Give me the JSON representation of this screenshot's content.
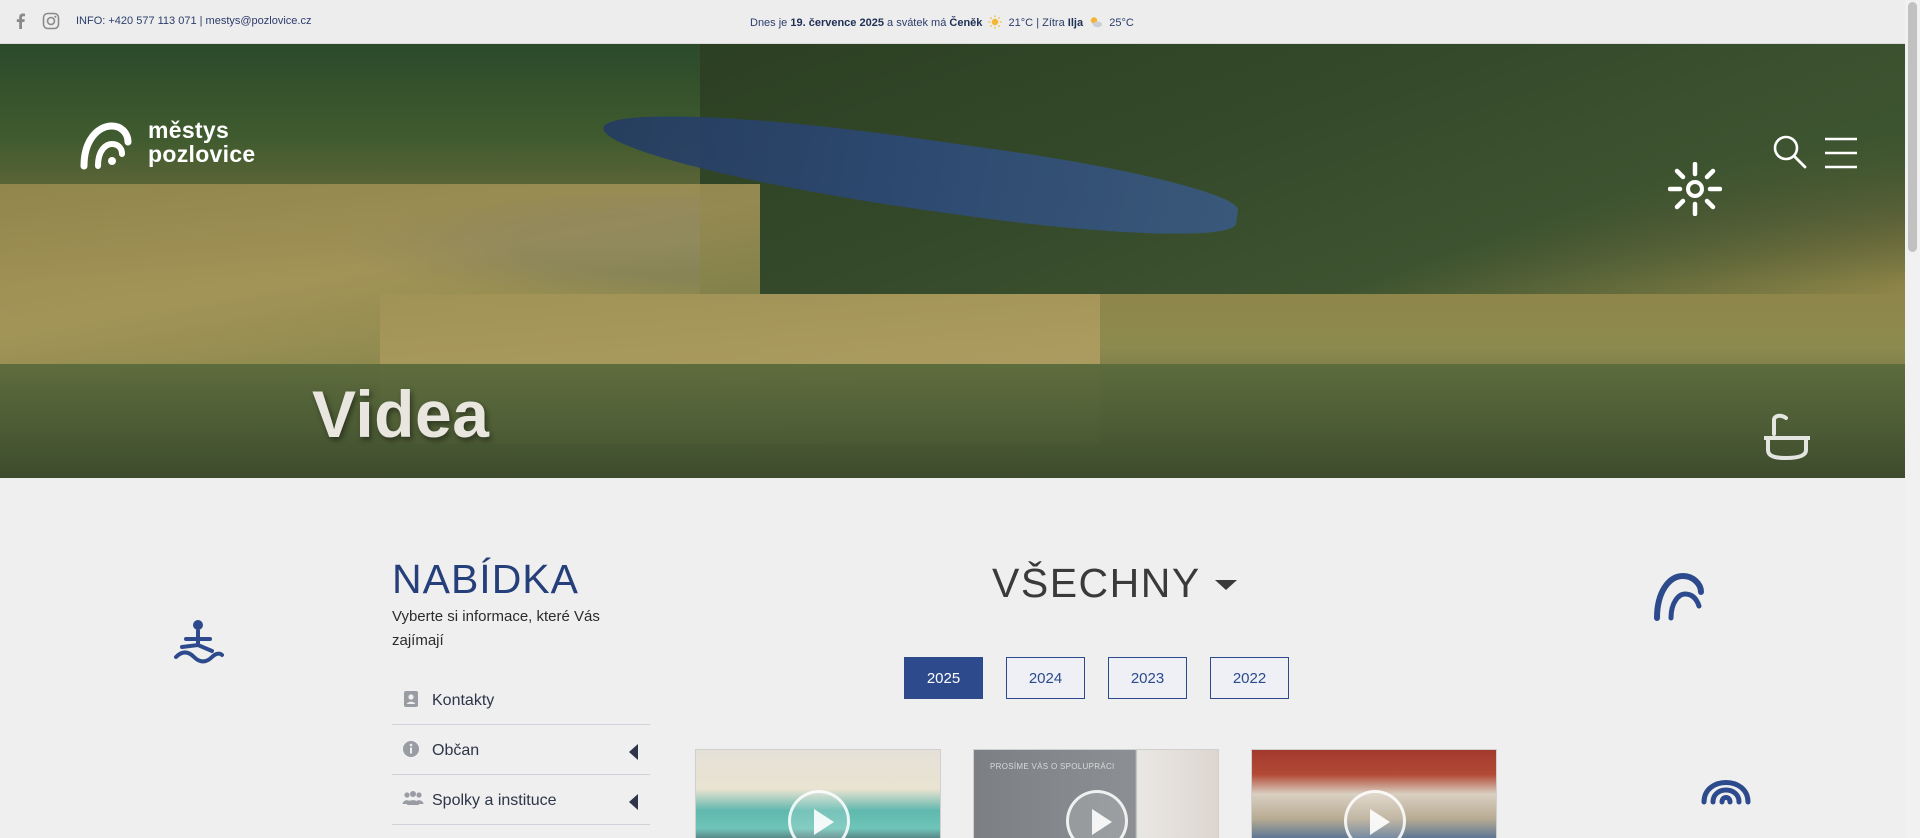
{
  "topbar": {
    "contact": "INFO: +420 577 113 071 | mestys@pozlovice.cz",
    "today_prefix": "Dnes je",
    "today_date": "19. července 2025",
    "nameday_prefix": "a svátek má",
    "nameday_name": "Čeněk",
    "temp_today": "21°C",
    "tomorrow_prefix": "| Zítra",
    "tomorrow_name": "Ilja",
    "temp_tomorrow": "25°C",
    "icons": [
      "facebook-icon",
      "instagram-icon",
      "sun-icon",
      "partly-cloudy-icon"
    ]
  },
  "header": {
    "logo_line1": "městys",
    "logo_line2": "pozlovice",
    "icons": [
      "search-icon",
      "menu-icon"
    ]
  },
  "hero": {
    "title": "Videa"
  },
  "sidebar": {
    "heading": "NABÍDKA",
    "subtitle": "Vyberte si informace, které Vás zajímají",
    "items": [
      {
        "label": "Kontakty",
        "icon": "contact-card-icon"
      },
      {
        "label": "Občan",
        "icon": "info-icon"
      },
      {
        "label": "Spolky a instituce",
        "icon": "group-icon"
      }
    ]
  },
  "filter": {
    "selected": "VŠECHNY"
  },
  "years": [
    "2025",
    "2024",
    "2023",
    "2022"
  ],
  "videos": {
    "card2_caption": "PROSÍME VÁS O SPOLUPRÁCI"
  },
  "colors": {
    "accent": "#2c4a8c",
    "heading": "#253f7a",
    "background": "#efefef"
  }
}
